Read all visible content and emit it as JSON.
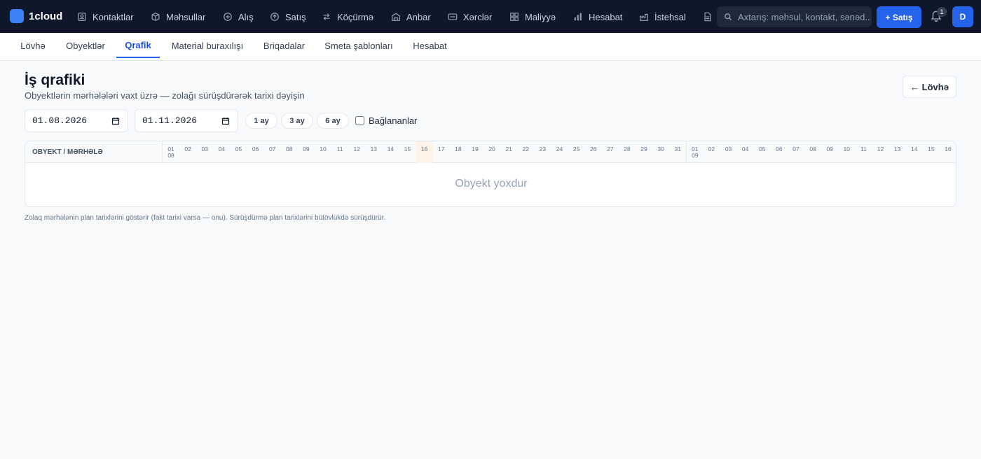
{
  "app": {
    "logo_text": "1cloud"
  },
  "topnav": {
    "items": [
      {
        "label": "Kontaktlar",
        "icon": "contacts-icon"
      },
      {
        "label": "Məhsullar",
        "icon": "box-icon"
      },
      {
        "label": "Alış",
        "icon": "purchase-icon"
      },
      {
        "label": "Satış",
        "icon": "sale-icon"
      },
      {
        "label": "Köçürmə",
        "icon": "transfer-icon"
      },
      {
        "label": "Anbar",
        "icon": "warehouse-icon"
      },
      {
        "label": "Xərclər",
        "icon": "expenses-icon"
      },
      {
        "label": "Maliyyə",
        "icon": "finance-grid-icon"
      },
      {
        "label": "Hesabat",
        "icon": "bar-chart-icon"
      },
      {
        "label": "İstehsal",
        "icon": "factory-icon"
      }
    ],
    "search_placeholder": "Axtarış: məhsul, kontakt, sənəd...",
    "new_sale_label": "+ Satış",
    "notification_count": "1",
    "avatar_initial": "D"
  },
  "subnav": {
    "tabs": [
      {
        "label": "Lövhə",
        "active": false
      },
      {
        "label": "Obyektlər",
        "active": false
      },
      {
        "label": "Qrafik",
        "active": true
      },
      {
        "label": "Material buraxılışı",
        "active": false
      },
      {
        "label": "Briqadalar",
        "active": false
      },
      {
        "label": "Smeta şablonları",
        "active": false
      },
      {
        "label": "Hesabat",
        "active": false
      }
    ]
  },
  "header": {
    "title": "İş qrafiki",
    "subtitle": "Obyektlərin mərhələləri vaxt üzrə — zolağı sürüşdürərək tarixi dəyişin",
    "back_label": "← Lövhə"
  },
  "controls": {
    "date_from": "01.08.2026",
    "date_to": "01.11.2026",
    "range_buttons": [
      "1 ay",
      "3 ay",
      "6 ay"
    ],
    "dependencies_label": "Bağlananlar",
    "dependencies_checked": false
  },
  "gantt": {
    "column_header": "OBYEKT / MƏRHƏLƏ",
    "months": [
      {
        "month": "08",
        "days": [
          "01",
          "02",
          "03",
          "04",
          "05",
          "06",
          "07",
          "08",
          "09",
          "10",
          "11",
          "12",
          "13",
          "14",
          "15",
          "16",
          "17",
          "18",
          "19",
          "20",
          "21",
          "22",
          "23",
          "24",
          "25",
          "26",
          "27",
          "28",
          "29",
          "30",
          "31"
        ]
      },
      {
        "month": "09",
        "days": [
          "01",
          "02",
          "03",
          "04",
          "05",
          "06",
          "07",
          "08",
          "09",
          "10",
          "11",
          "12",
          "13",
          "14",
          "15",
          "16"
        ]
      }
    ],
    "today_day": "16",
    "today_month": "08",
    "empty_text": "Obyekt yoxdur"
  },
  "footnote": "Zolaq mərhələnin plan tarixlərini göstərir (fakt tarixi varsa — onu). Sürüşdürmə plan tarixlərini bütövlükdə sürüşdürür."
}
